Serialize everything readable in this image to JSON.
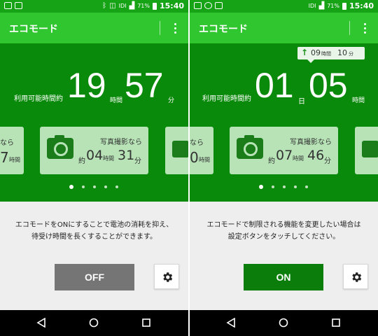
{
  "status_bar": {
    "time": "15:40",
    "battery": "71%",
    "signal": "IDI"
  },
  "left": {
    "app_title": "エコモード",
    "hero": {
      "label": "利用可能時間",
      "prefix": "約",
      "hours": "19",
      "hours_unit": "時間",
      "minutes": "57",
      "minutes_unit": "分"
    },
    "card_prev": {
      "title_fragment": "なら",
      "value_fragment": "7",
      "unit": "時間"
    },
    "card_main": {
      "title": "写真撮影なら",
      "prefix": "約",
      "hours": "04",
      "hours_unit": "時間",
      "minutes": "31",
      "minutes_unit": "分"
    },
    "description_line1": "エコモードをONにすることで電池の消耗を抑え、",
    "description_line2": "待受け時間を長くすることができます。",
    "toggle_label": "OFF"
  },
  "right": {
    "app_title": "エコモード",
    "badge": {
      "hours": "09",
      "hours_unit": "時間",
      "minutes": "10",
      "minutes_unit": "分"
    },
    "hero": {
      "label": "利用可能時間",
      "prefix": "約",
      "days": "01",
      "days_unit": "日",
      "hours": "05",
      "hours_unit": "時間"
    },
    "card_prev": {
      "title_fragment": "なら",
      "value_fragment": "0",
      "unit": "時間"
    },
    "card_main": {
      "title": "写真撮影なら",
      "prefix": "約",
      "hours": "07",
      "hours_unit": "時間",
      "minutes": "46",
      "minutes_unit": "分"
    },
    "description_line1": "エコモードで制限される機能を変更したい場合は",
    "description_line2": "設定ボタンをタッチしてください。",
    "toggle_label": "ON"
  },
  "colors": {
    "status_bar": "#16a316",
    "app_bar": "#2fc62f",
    "hero": "#0a8a0a",
    "card": "#b7e3b7",
    "off_button": "#757575",
    "on_button": "#0a7d0a"
  },
  "icons": [
    "camera-icon",
    "gear-icon",
    "back-icon",
    "home-icon",
    "recents-icon",
    "more-vert-icon",
    "arrow-up-icon"
  ]
}
